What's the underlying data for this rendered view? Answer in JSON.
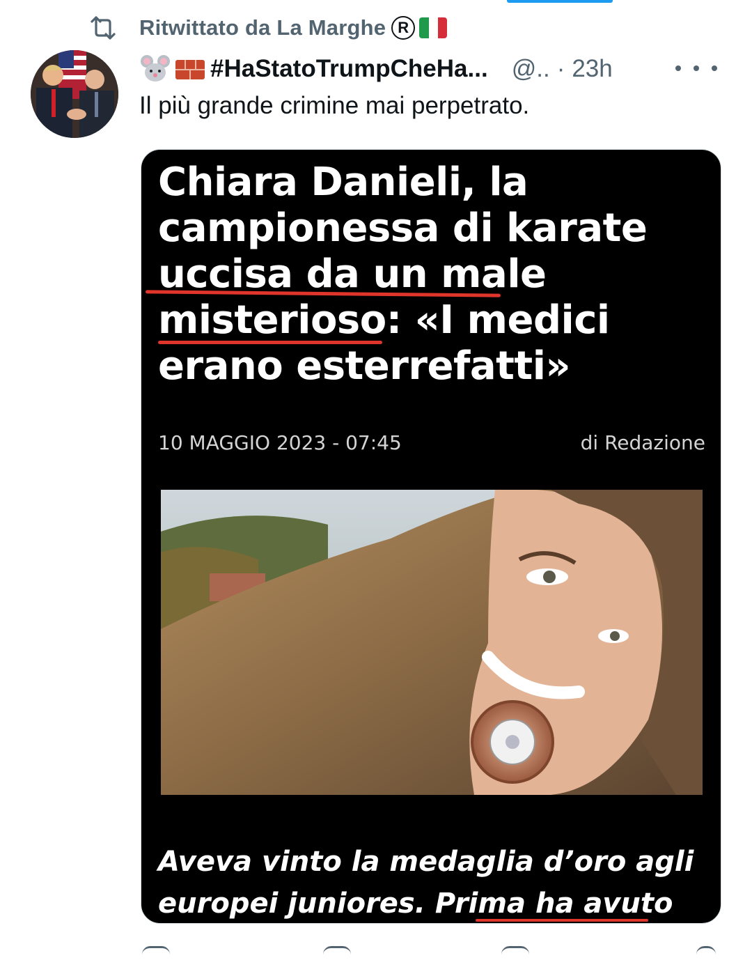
{
  "retweet": {
    "label": "Ritwittato da La Marghe",
    "registered_mark": "R",
    "icon": "retweet-icon",
    "flag": "italy-flag-icon"
  },
  "tweet": {
    "avatar": "avatar-image",
    "emoji": [
      "mouse-emoji",
      "brick-emoji"
    ],
    "display_name": "#HaStatoTrumpCheHa...",
    "handle": "@..",
    "separator": "·",
    "time": "23h",
    "more_icon": "more-icon",
    "text": "Il più grande crimine mai perpetrato."
  },
  "media": {
    "headline_lines": [
      "Chiara Danieli, la",
      "campionessa di karate",
      "uccisa da un male",
      "misterioso: «I medici",
      "erano esterrefatti»"
    ],
    "date": "10 MAGGIO 2023 - 07:45",
    "byline": "di Redazione",
    "photo": "photo-woman-with-medal",
    "caption_lines": [
      "Aveva vinto la medaglia d’oro agli",
      "europei juniores. Prima ha avuto"
    ]
  },
  "colors": {
    "accent": "#1d9bf0",
    "secondary_text": "#536471",
    "underline_red": "#e0352b"
  }
}
